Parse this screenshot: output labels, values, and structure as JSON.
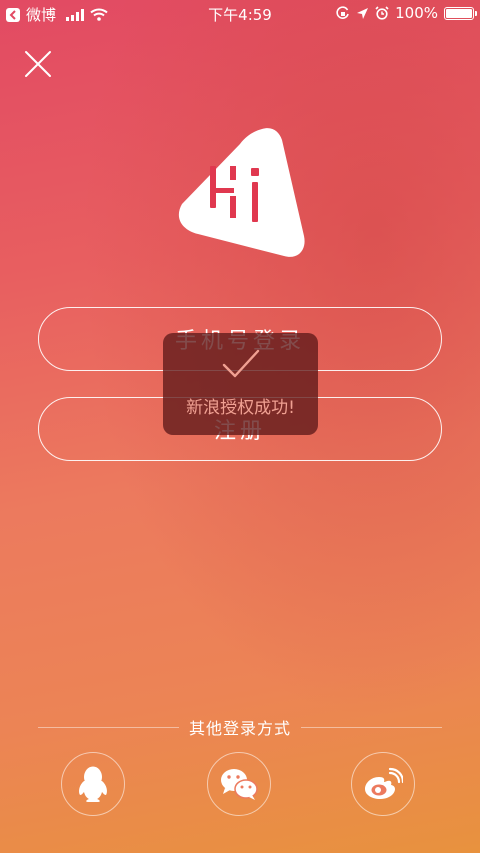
{
  "status_bar": {
    "back_app": "微博",
    "time": "下午4:59",
    "battery": "100%"
  },
  "logo_text": "Hi",
  "buttons": {
    "phone_login": "手机号登录",
    "register": "注册"
  },
  "toast": {
    "message": "新浪授权成功!"
  },
  "other_login": {
    "title": "其他登录方式",
    "options": [
      "qq-icon",
      "wechat-icon",
      "weibo-icon"
    ]
  },
  "colors": {
    "gradient_top": "#e24a63",
    "gradient_bottom": "#e8923e",
    "logo_accent": "#e0384f",
    "toast_bg": "#5f1919",
    "toast_text": "#f0a092"
  }
}
